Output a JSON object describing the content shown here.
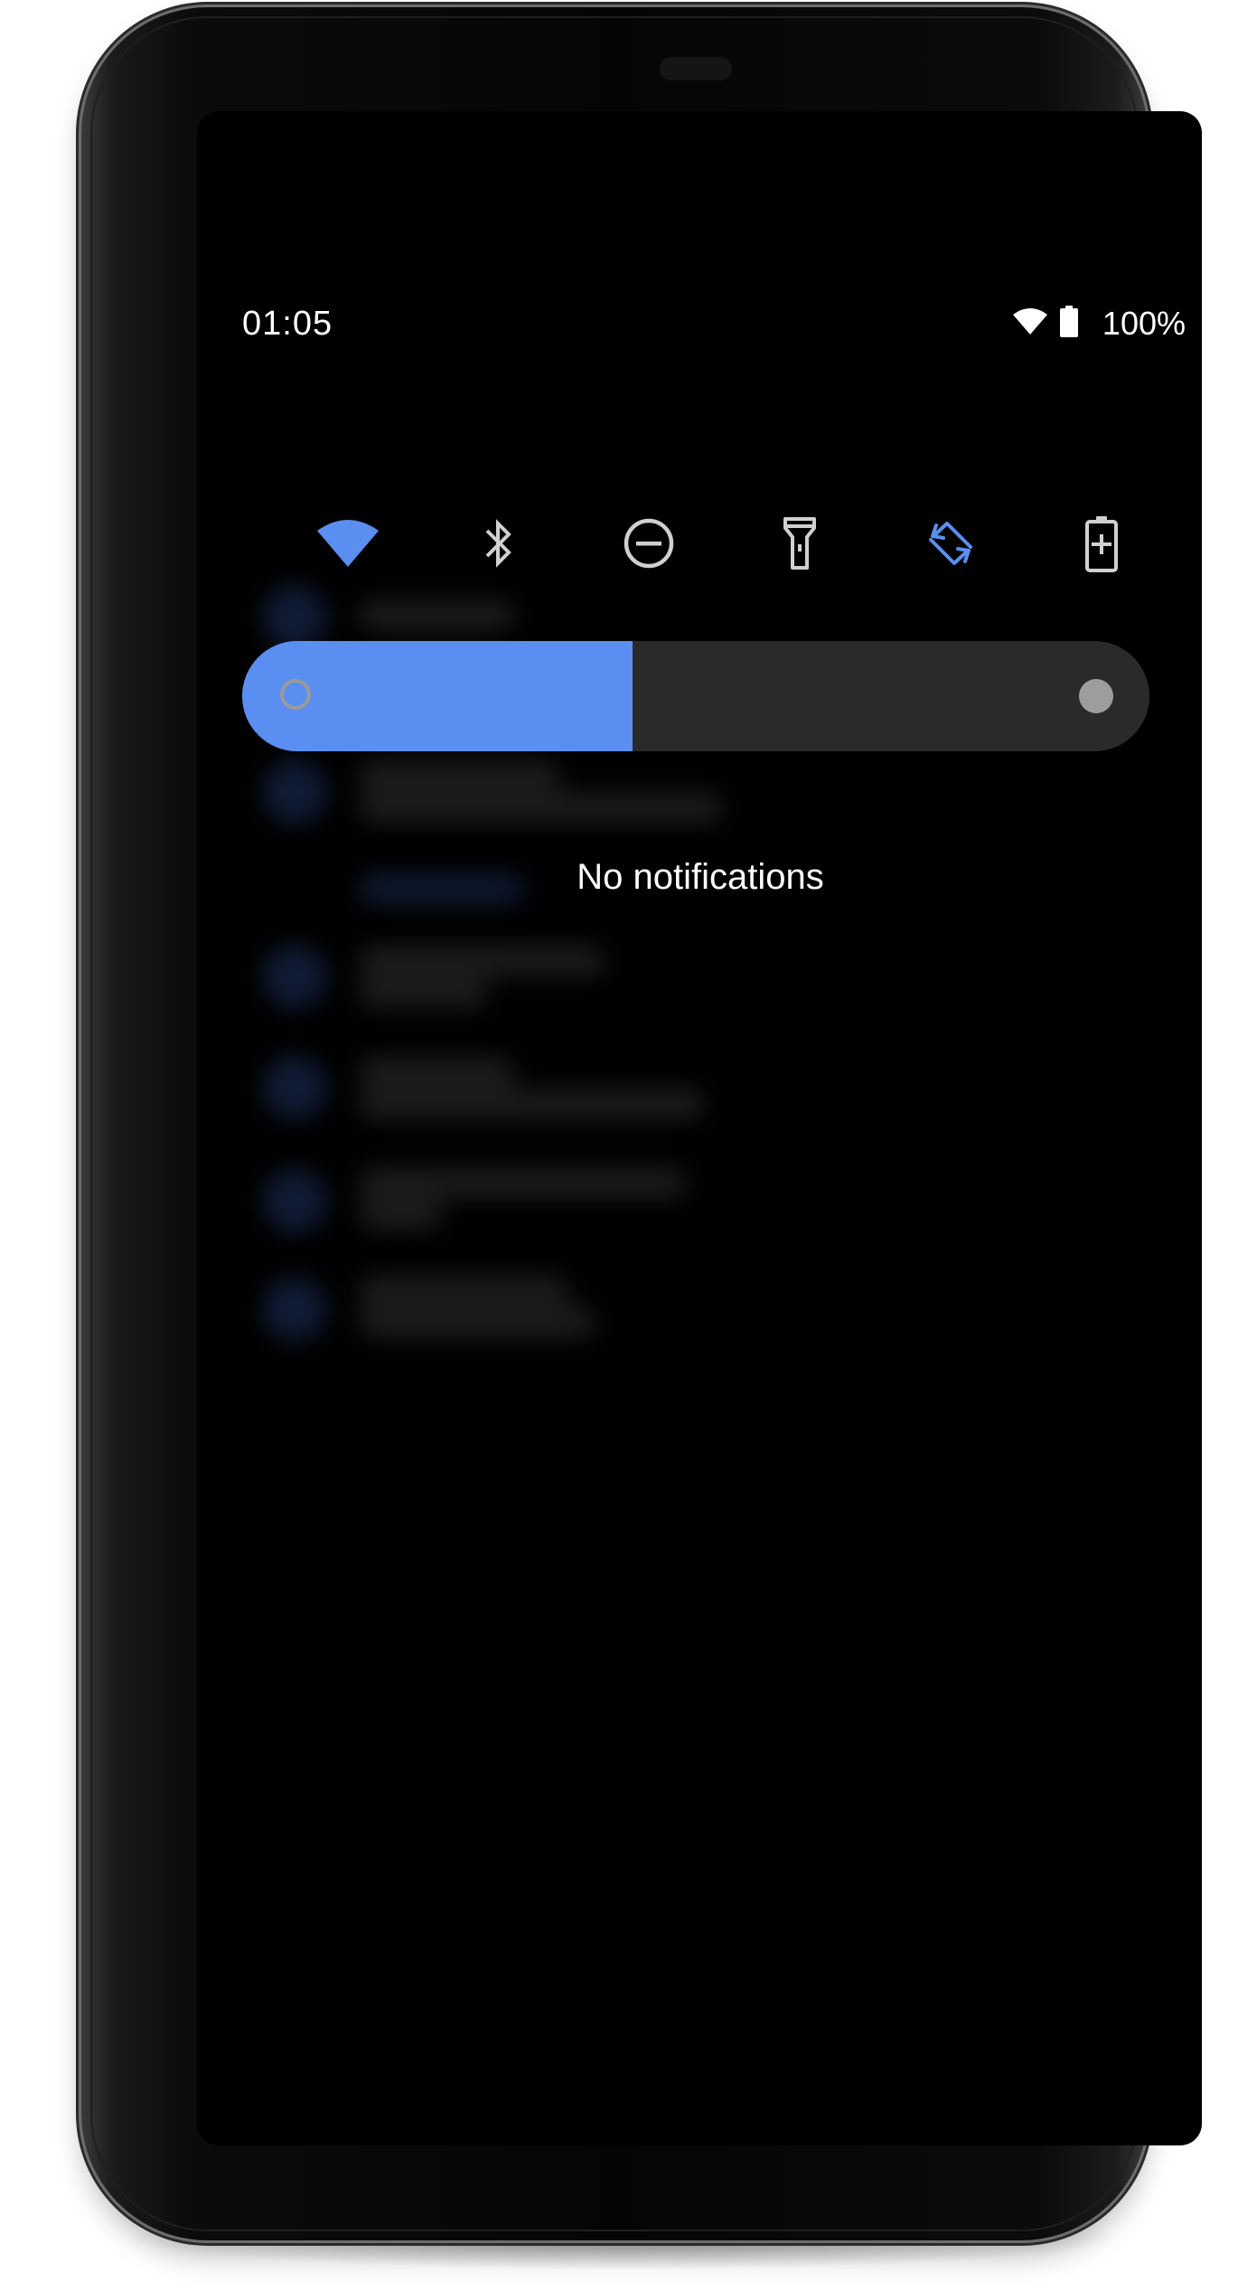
{
  "status_bar": {
    "time": "01:05",
    "battery_percent_label": "100%",
    "icons": [
      "wifi-icon",
      "battery-icon"
    ]
  },
  "quick_settings": {
    "tiles": [
      {
        "name": "wifi",
        "icon": "wifi-icon",
        "active": true
      },
      {
        "name": "bluetooth",
        "icon": "bluetooth-icon",
        "active": false
      },
      {
        "name": "do-not-disturb",
        "icon": "do-not-disturb-icon",
        "active": false
      },
      {
        "name": "flashlight",
        "icon": "flashlight-icon",
        "active": false
      },
      {
        "name": "auto-rotate",
        "icon": "auto-rotate-icon",
        "active": true
      },
      {
        "name": "battery-saver",
        "icon": "battery-saver-icon",
        "active": false
      }
    ]
  },
  "brightness": {
    "level": 0.43
  },
  "notifications": {
    "empty_message": "No notifications"
  },
  "colors": {
    "accent": "#5a8ef0",
    "icon_inactive": "#d0d0d0",
    "slider_track": "#2a2a2a",
    "screen_background": "#000000",
    "text": "#ffffff"
  }
}
